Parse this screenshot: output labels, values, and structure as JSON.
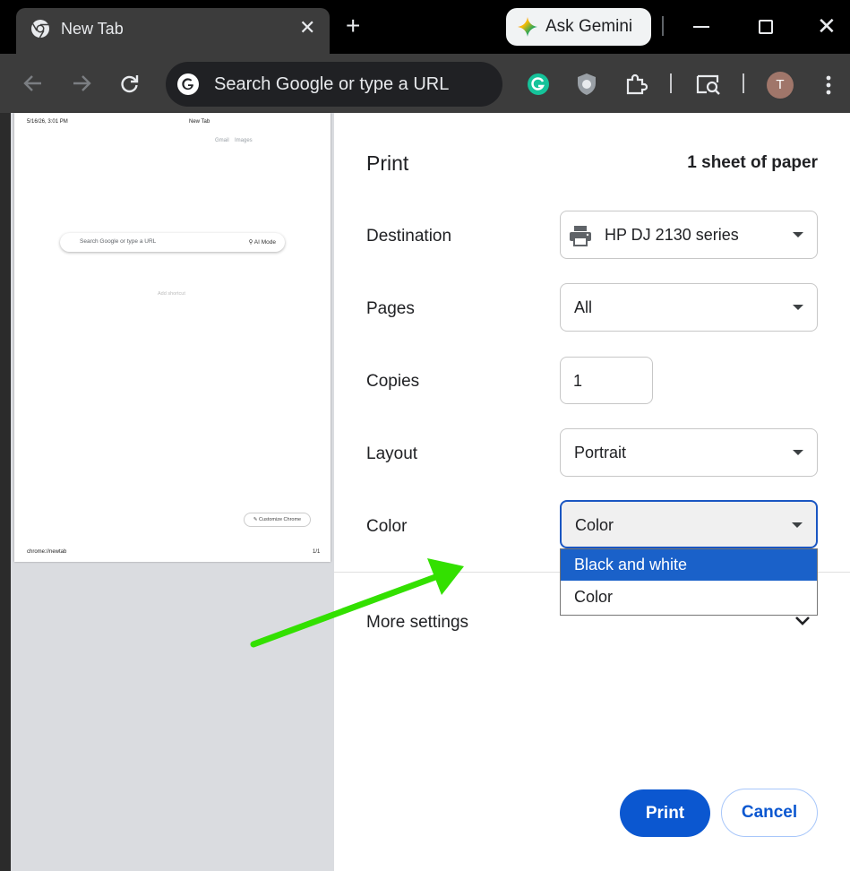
{
  "tab": {
    "title": "New Tab",
    "favicon": "chrome-icon"
  },
  "gemini": {
    "label": "Ask Gemini"
  },
  "omnibox": {
    "text": "Search Google or type a URL"
  },
  "profile": {
    "initial": "T"
  },
  "preview": {
    "datetime": "5/16/26, 3:01 PM",
    "page_title": "New Tab",
    "links": [
      "Gmail",
      "Images"
    ],
    "search_placeholder": "Search Google or type a URL",
    "ai_mode": "AI Mode",
    "add_shortcut": "Add shortcut",
    "customize": "Customize Chrome",
    "footer_url": "chrome://newtab",
    "page_count": "1/1"
  },
  "print": {
    "title": "Print",
    "sheets": "1 sheet of paper",
    "destination": {
      "label": "Destination",
      "value": "HP DJ 2130 series"
    },
    "pages": {
      "label": "Pages",
      "value": "All"
    },
    "copies": {
      "label": "Copies",
      "value": "1"
    },
    "layout": {
      "label": "Layout",
      "value": "Portrait"
    },
    "color": {
      "label": "Color",
      "value": "Color",
      "options": [
        "Black and white",
        "Color"
      ],
      "highlighted": "Black and white"
    },
    "more_settings": "More settings",
    "print_button": "Print",
    "cancel_button": "Cancel"
  },
  "colors": {
    "accent": "#0b57d0",
    "dropdown_highlight": "#1a61c9",
    "annotation_arrow": "#33e000"
  }
}
